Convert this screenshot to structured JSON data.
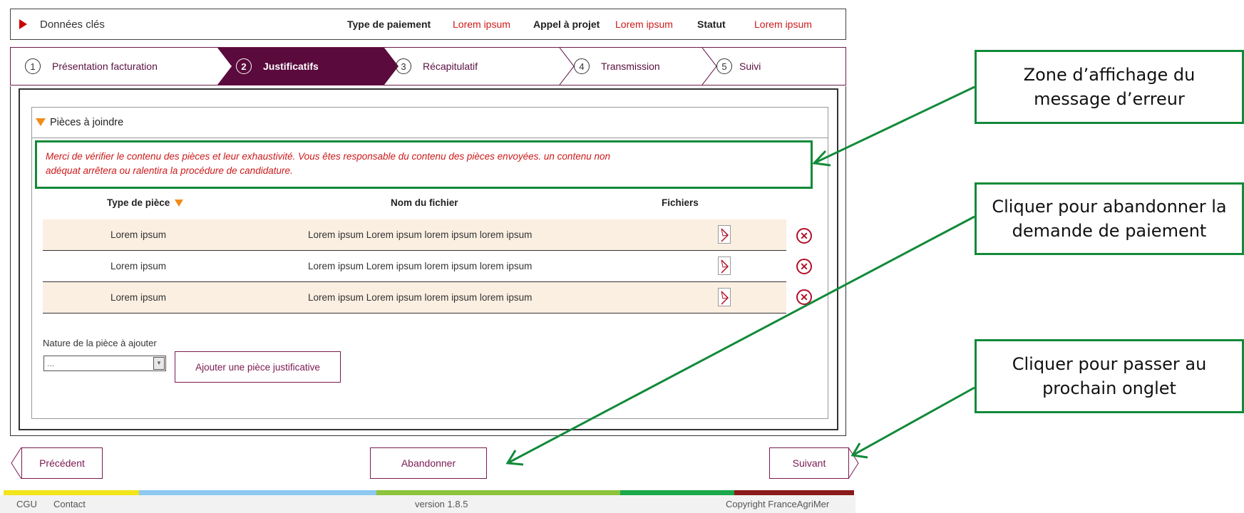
{
  "keydata": {
    "title": "Données clés",
    "payment_type_label": "Type de paiement",
    "payment_type_value": "Lorem ipsum",
    "project_call_label": "Appel à projet",
    "project_call_value": "Lorem ipsum",
    "status_label": "Statut",
    "status_value": "Lorem ipsum"
  },
  "steps": [
    {
      "num": "1",
      "label": "Présentation facturation"
    },
    {
      "num": "2",
      "label": "Justificatifs"
    },
    {
      "num": "3",
      "label": "Récapitulatif"
    },
    {
      "num": "4",
      "label": "Transmission"
    },
    {
      "num": "5",
      "label": "Suivi"
    }
  ],
  "section": {
    "title": "Pièces à joindre",
    "error_line1": "Merci de vérifier le contenu des pièces et leur exhaustivité. Vous êtes responsable du contenu des pièces envoyées. un contenu non",
    "error_line2": "adéquat arrêtera ou ralentira la procédure de candidature."
  },
  "table": {
    "headers": [
      "Type de pièce",
      "Nom du fichier",
      "Fichiers"
    ],
    "rows": [
      {
        "type": "Lorem ipsum",
        "filename": "Lorem ipsum Lorem ipsum  lorem ipsum lorem ipsum"
      },
      {
        "type": "Lorem ipsum",
        "filename": "Lorem ipsum Lorem ipsum  lorem ipsum lorem ipsum"
      },
      {
        "type": "Lorem ipsum",
        "filename": "Lorem ipsum Lorem ipsum  lorem ipsum lorem ipsum"
      }
    ]
  },
  "add_piece": {
    "label": "Nature de la pièce à ajouter",
    "select_value": "...",
    "button": "Ajouter une pièce justificative"
  },
  "nav": {
    "previous": "Précédent",
    "abandon": "Abandonner",
    "next": "Suivant"
  },
  "footer": {
    "cgu": "CGU",
    "contact": "Contact",
    "version": "version 1.8.5",
    "copyright": "Copyright FranceAgriMer"
  },
  "annotations": {
    "error_zone": "Zone d’affichage du message d’erreur",
    "abandon": "Cliquer pour abandonner la demande de paiement",
    "next_tab": "Cliquer pour passer au prochain onglet"
  },
  "colors": {
    "brand": "#5a0a3c",
    "error_red": "#cc1a1a",
    "annotation_green": "#128a3a",
    "row_alt": "#fbefe2"
  }
}
